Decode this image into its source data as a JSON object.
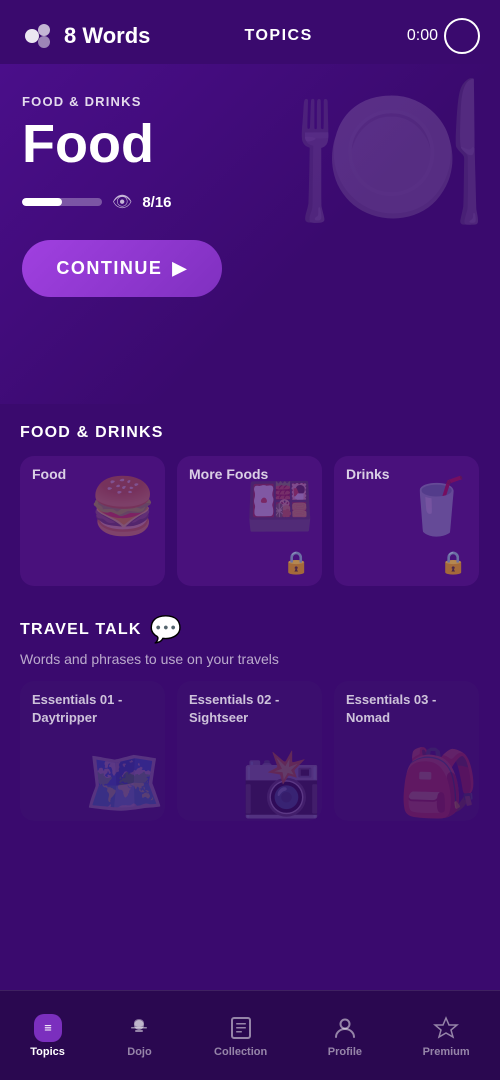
{
  "header": {
    "app_title": "8 Words",
    "topics_label": "TOPICS",
    "timer": "0:00"
  },
  "hero": {
    "category": "FOOD & DRINKS",
    "topic_title": "Food",
    "progress_filled": 50,
    "progress_text": "8/16"
  },
  "continue_button": {
    "label": "CONTINUE"
  },
  "food_section": {
    "title": "FOOD & DRINKS",
    "cards": [
      {
        "title": "Food",
        "icon": "🍔",
        "locked": false
      },
      {
        "title": "More Foods",
        "icon": "🍱",
        "locked": true
      },
      {
        "title": "Drinks",
        "icon": "🥤",
        "locked": true
      }
    ]
  },
  "travel_section": {
    "title": "TRAVEL TALK",
    "subtitle": "Words and phrases to use on your travels",
    "cards": [
      {
        "title": "Essentials 01 - Daytripper",
        "icon": "🗺️"
      },
      {
        "title": "Essentials 02 - Sightseer",
        "icon": "📸"
      },
      {
        "title": "Essentials 03 - Nomad",
        "icon": "🎒"
      }
    ]
  },
  "bottom_nav": {
    "items": [
      {
        "id": "topics",
        "label": "Topics",
        "icon": "☰",
        "active": true
      },
      {
        "id": "dojo",
        "label": "Dojo",
        "icon": "🥷",
        "active": false
      },
      {
        "id": "collection",
        "label": "Collection",
        "icon": "📋",
        "active": false
      },
      {
        "id": "profile",
        "label": "Profile",
        "icon": "👤",
        "active": false
      },
      {
        "id": "premium",
        "label": "Premium",
        "icon": "💎",
        "active": false
      }
    ]
  }
}
